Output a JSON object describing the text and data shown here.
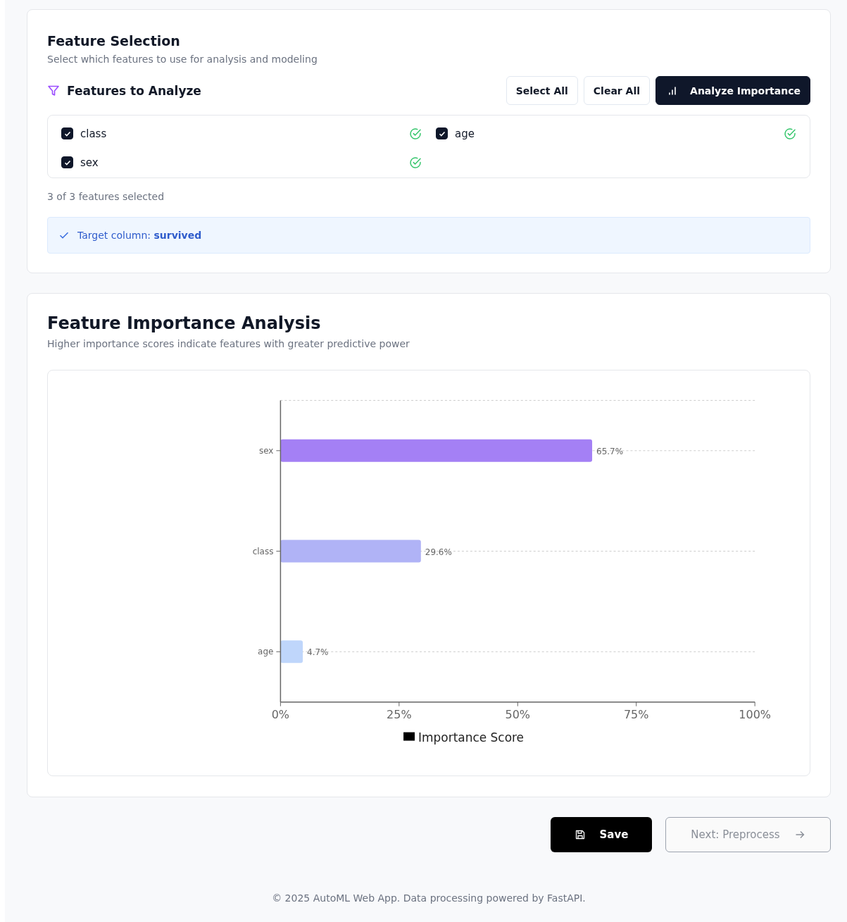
{
  "feature_selection": {
    "title": "Feature Selection",
    "subtitle": "Select which features to use for analysis and modeling",
    "section_title": "Features to Analyze",
    "actions": [
      {
        "kind": "outline",
        "label": "Select All"
      },
      {
        "kind": "outline",
        "label": "Clear All"
      },
      {
        "kind": "primary",
        "label": "Analyze Importance"
      }
    ],
    "features": [
      {
        "name": "class",
        "checked": true
      },
      {
        "name": "age",
        "checked": true
      },
      {
        "name": "sex",
        "checked": true
      }
    ],
    "count_text": "3 of 3 features selected",
    "target_label": "Target column:",
    "target_value": "survived"
  },
  "importance": {
    "title": "Feature Importance Analysis",
    "subtitle": "Higher importance scores indicate features with greater predictive power",
    "bars": [
      {
        "color": "#a480f5"
      },
      {
        "color": "#b0b3f6"
      },
      {
        "color": "#bfd6fb"
      }
    ],
    "chart_data": {
      "type": "bar",
      "orientation": "horizontal",
      "categories": [
        "sex",
        "class",
        "age"
      ],
      "series": [
        {
          "name": "Importance Score",
          "values": [
            65.7,
            29.6,
            4.7
          ]
        }
      ],
      "xlim": [
        0,
        100
      ],
      "xticks": [
        {
          "value": 0,
          "label": "0%"
        },
        {
          "value": 25,
          "label": "25%"
        },
        {
          "value": 50,
          "label": "50%"
        },
        {
          "value": 75,
          "label": "75%"
        },
        {
          "value": 100,
          "label": "100%"
        }
      ],
      "value_labels": [
        "65.7%",
        "29.6%",
        "4.7%"
      ]
    }
  },
  "footer_actions": [
    {
      "kind": "save",
      "label": "Save",
      "disabled": false
    },
    {
      "kind": "next",
      "label": "Next: Preprocess",
      "disabled": true
    }
  ],
  "copyright": "© 2025 AutoML Web App. Data processing powered by FastAPI."
}
